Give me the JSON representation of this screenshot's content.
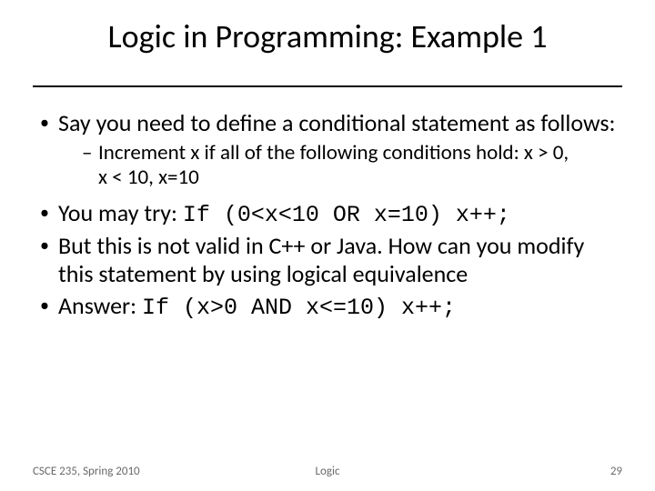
{
  "title": "Logic in Programming: Example 1",
  "bullets": {
    "b1": "Say you need to define a conditional statement as follows:",
    "sub1": "Increment x if all of the following conditions hold: x > 0, x < 10, x=10",
    "b2_pre": "You may try: ",
    "b2_code": "If (0<x<10 OR x=10) x++;",
    "b3": "But this is not valid in C++ or Java. How can you modify this statement by using logical equivalence",
    "b4_pre": "Answer: ",
    "b4_code": "If (x>0 AND x<=10) x++;"
  },
  "footer": {
    "left": "CSCE 235, Spring 2010",
    "center": "Logic",
    "page": "29"
  }
}
